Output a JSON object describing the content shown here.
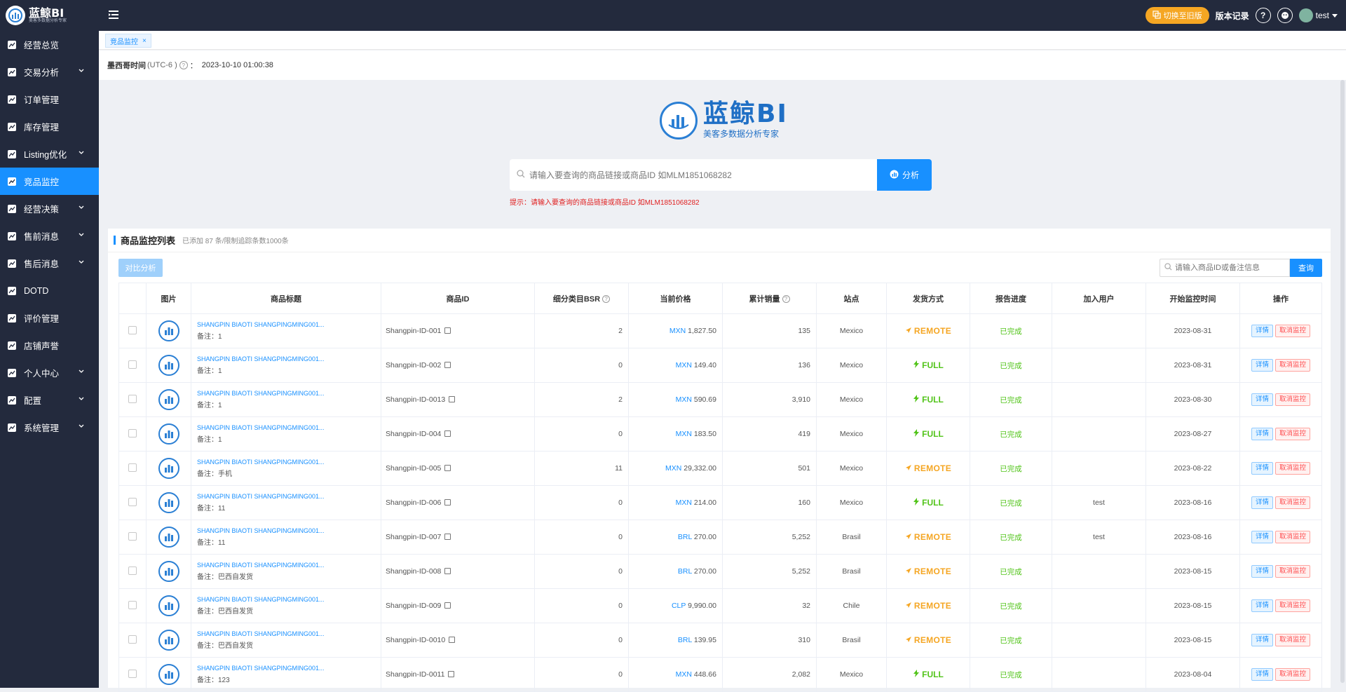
{
  "app": {
    "title": "蓝鲸BI",
    "subtitle": "美客多数据分析专家"
  },
  "sidebar": {
    "items": [
      {
        "label": "经营总览",
        "icon": "chart-line-icon",
        "has_children": false
      },
      {
        "label": "交易分析",
        "icon": "chart-area-icon",
        "has_children": true
      },
      {
        "label": "订单管理",
        "icon": "order-icon",
        "has_children": false
      },
      {
        "label": "库存管理",
        "icon": "inventory-icon",
        "has_children": false
      },
      {
        "label": "Listing优化",
        "icon": "listing-icon",
        "has_children": true
      },
      {
        "label": "竞品监控",
        "icon": "monitor-icon",
        "has_children": false,
        "active": true
      },
      {
        "label": "经营决策",
        "icon": "decision-icon",
        "has_children": true
      },
      {
        "label": "售前消息",
        "icon": "message-icon",
        "has_children": true
      },
      {
        "label": "售后消息",
        "icon": "chat-icon",
        "has_children": true
      },
      {
        "label": "DOTD",
        "icon": "lock-icon",
        "has_children": false
      },
      {
        "label": "评价管理",
        "icon": "review-icon",
        "has_children": false
      },
      {
        "label": "店铺声誉",
        "icon": "reputation-icon",
        "has_children": false
      },
      {
        "label": "个人中心",
        "icon": "user-icon",
        "has_children": true
      },
      {
        "label": "配置",
        "icon": "config-icon",
        "has_children": true
      },
      {
        "label": "系统管理",
        "icon": "system-icon",
        "has_children": true
      }
    ]
  },
  "topbar": {
    "switch_label": "切换至旧版",
    "version_label": "版本记录",
    "help_icon": "?",
    "user": "test"
  },
  "tabs": [
    {
      "label": "竞品监控"
    }
  ],
  "time": {
    "label": "墨西哥时间",
    "tz": "(UTC-6 )",
    "sep": "：",
    "value": "2023-10-10 01:00:38"
  },
  "hero": {
    "brand": "蓝鲸BI",
    "brand_sub": "美客多数据分析专家",
    "search_placeholder": "请输入要查询的商品链接或商品ID 如MLM1851068282",
    "analyze_label": "分析",
    "hint": "提示：请输入要查询的商品链接或商品ID 如MLM1851068282"
  },
  "panel": {
    "title": "商品监控列表",
    "subtitle": "已添加 87 条/限制追踪条数1000条",
    "compare_label": "对比分析",
    "search_placeholder": "请输入商品ID或备注信息",
    "query_label": "查询",
    "columns": [
      "",
      "图片",
      "商品标题",
      "商品ID",
      "细分类目BSR",
      "当前价格",
      "累计销量",
      "站点",
      "发货方式",
      "报告进度",
      "加入用户",
      "开始监控时间",
      "操作"
    ],
    "detail_label": "详情",
    "cancel_label": "取消监控",
    "rows": [
      {
        "title": "SHANGPIN BIAOTI SHANGPINGMING001...",
        "note": "备注：1",
        "id": "Shangpin-ID-001",
        "bsr": "2",
        "currency": "MXN",
        "price": "1,827.50",
        "sales": "135",
        "site": "Mexico",
        "ship": "REMOTE",
        "progress": "已完成",
        "user": "",
        "start": "2023-08-31"
      },
      {
        "title": "SHANGPIN BIAOTI SHANGPINGMING001...",
        "note": "备注：1",
        "id": "Shangpin-ID-002",
        "bsr": "0",
        "currency": "MXN",
        "price": "149.40",
        "sales": "136",
        "site": "Mexico",
        "ship": "FULL",
        "progress": "已完成",
        "user": "",
        "start": "2023-08-31"
      },
      {
        "title": "SHANGPIN BIAOTI SHANGPINGMING001...",
        "note": "备注：1",
        "id": "Shangpin-ID-0013",
        "bsr": "2",
        "currency": "MXN",
        "price": "590.69",
        "sales": "3,910",
        "site": "Mexico",
        "ship": "FULL",
        "progress": "已完成",
        "user": "",
        "start": "2023-08-30"
      },
      {
        "title": "SHANGPIN BIAOTI SHANGPINGMING001...",
        "note": "备注：1",
        "id": "Shangpin-ID-004",
        "bsr": "0",
        "currency": "MXN",
        "price": "183.50",
        "sales": "419",
        "site": "Mexico",
        "ship": "FULL",
        "progress": "已完成",
        "user": "",
        "start": "2023-08-27"
      },
      {
        "title": "SHANGPIN BIAOTI SHANGPINGMING001...",
        "note": "备注：手机",
        "id": "Shangpin-ID-005",
        "bsr": "11",
        "currency": "MXN",
        "price": "29,332.00",
        "sales": "501",
        "site": "Mexico",
        "ship": "REMOTE",
        "progress": "已完成",
        "user": "",
        "start": "2023-08-22"
      },
      {
        "title": "SHANGPIN BIAOTI SHANGPINGMING001...",
        "note": "备注：11",
        "id": "Shangpin-ID-006",
        "bsr": "0",
        "currency": "MXN",
        "price": "214.00",
        "sales": "160",
        "site": "Mexico",
        "ship": "FULL",
        "progress": "已完成",
        "user": "test",
        "start": "2023-08-16"
      },
      {
        "title": "SHANGPIN BIAOTI SHANGPINGMING001...",
        "note": "备注：11",
        "id": "Shangpin-ID-007",
        "bsr": "0",
        "currency": "BRL",
        "price": "270.00",
        "sales": "5,252",
        "site": "Brasil",
        "ship": "REMOTE",
        "progress": "已完成",
        "user": "test",
        "start": "2023-08-16"
      },
      {
        "title": "SHANGPIN BIAOTI SHANGPINGMING001...",
        "note": "备注：巴西自发货",
        "id": "Shangpin-ID-008",
        "bsr": "0",
        "currency": "BRL",
        "price": "270.00",
        "sales": "5,252",
        "site": "Brasil",
        "ship": "REMOTE",
        "progress": "已完成",
        "user": "",
        "start": "2023-08-15"
      },
      {
        "title": "SHANGPIN BIAOTI SHANGPINGMING001...",
        "note": "备注：巴西自发货",
        "id": "Shangpin-ID-009",
        "bsr": "0",
        "currency": "CLP",
        "price": "9,990.00",
        "sales": "32",
        "site": "Chile",
        "ship": "REMOTE",
        "progress": "已完成",
        "user": "",
        "start": "2023-08-15"
      },
      {
        "title": "SHANGPIN BIAOTI SHANGPINGMING001...",
        "note": "备注：巴西自发货",
        "id": "Shangpin-ID-0010",
        "bsr": "0",
        "currency": "BRL",
        "price": "139.95",
        "sales": "310",
        "site": "Brasil",
        "ship": "REMOTE",
        "progress": "已完成",
        "user": "",
        "start": "2023-08-15"
      },
      {
        "title": "SHANGPIN BIAOTI SHANGPINGMING001...",
        "note": "备注：123",
        "id": "Shangpin-ID-0011",
        "bsr": "0",
        "currency": "MXN",
        "price": "448.66",
        "sales": "2,082",
        "site": "Mexico",
        "ship": "FULL",
        "progress": "已完成",
        "user": "",
        "start": "2023-08-04"
      }
    ]
  },
  "colors": {
    "sidebar_bg": "#232a3d",
    "accent": "#1890ff",
    "remote": "#f5a623",
    "full": "#52c41a",
    "cancel": "#ff4d4f"
  }
}
